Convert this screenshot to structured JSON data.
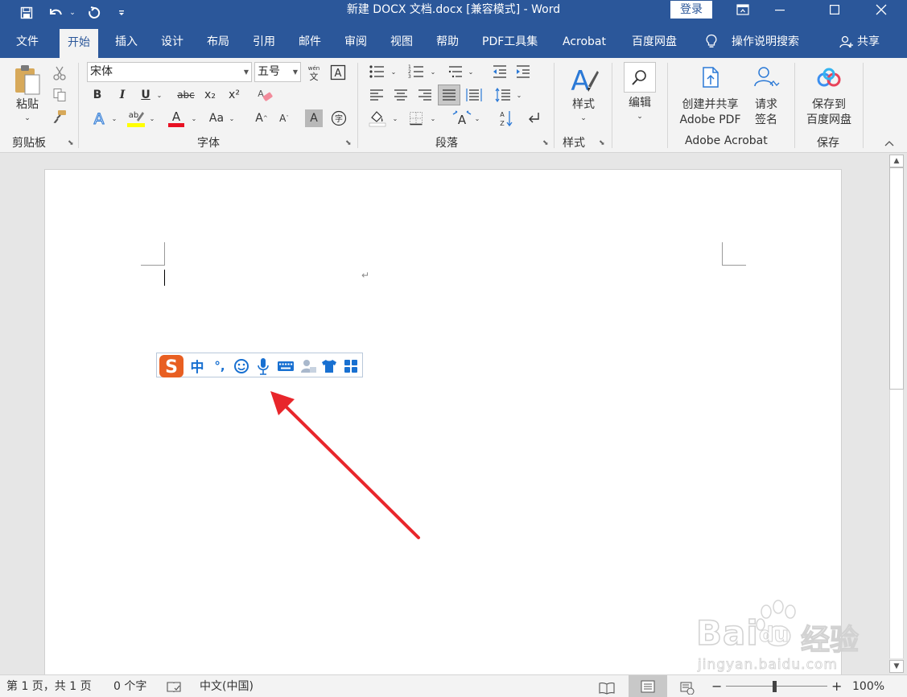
{
  "title_bar": {
    "document_title": "新建 DOCX 文档.docx [兼容模式]  -  Word",
    "login_label": "登录",
    "quick_access": [
      "save-icon",
      "undo-icon",
      "redo-icon",
      "customize-icon"
    ]
  },
  "tabs": [
    "文件",
    "开始",
    "插入",
    "设计",
    "布局",
    "引用",
    "邮件",
    "审阅",
    "视图",
    "帮助",
    "PDF工具集",
    "Acrobat",
    "百度网盘"
  ],
  "active_tab": "开始",
  "tell_me": "操作说明搜索",
  "share_label": "共享",
  "ribbon": {
    "clipboard": {
      "group_label": "剪贴板",
      "paste_label": "粘贴"
    },
    "font": {
      "group_label": "字体",
      "font_name": "宋体",
      "font_size": "五号",
      "phonetic_guide": "wén\n文",
      "bold": "B",
      "italic": "I",
      "underline": "U",
      "strike": "abc",
      "subscript": "x₂",
      "superscript": "x²",
      "change_case": "Aa",
      "grow": "A",
      "shrink": "A",
      "char_shading": "A",
      "enclose": "字",
      "font_color_hex": "#e81123",
      "highlight_hex": "#ffff00"
    },
    "paragraph": {
      "group_label": "段落"
    },
    "styles": {
      "group_label": "样式",
      "styles_label": "样式"
    },
    "editing": {
      "editing_label": "编辑"
    },
    "adobe": {
      "group_label": "Adobe Acrobat",
      "create_share_line1": "创建并共享",
      "create_share_line2": "Adobe PDF",
      "request_sign_line1": "请求",
      "request_sign_line2": "签名"
    },
    "save": {
      "group_label": "保存",
      "save_baidu_line1": "保存到",
      "save_baidu_line2": "百度网盘"
    }
  },
  "ime_toolbar": {
    "logo": "S",
    "mode": "中",
    "punct": "°,"
  },
  "status_bar": {
    "page": "第 1 页，共 1 页",
    "words": "0 个字",
    "language": "中文(中国)",
    "zoom": "100%",
    "zoom_level_pct": 100
  },
  "watermark": {
    "brand_latin": "Bai",
    "brand_du": "du",
    "brand_cn": "经验",
    "url": "jingyan.baidu.com"
  },
  "colors": {
    "ribbon_blue": "#2b579a",
    "sogou_orange": "#e85f22",
    "ime_blue": "#1870d1",
    "arrow_red": "#e8262b"
  }
}
